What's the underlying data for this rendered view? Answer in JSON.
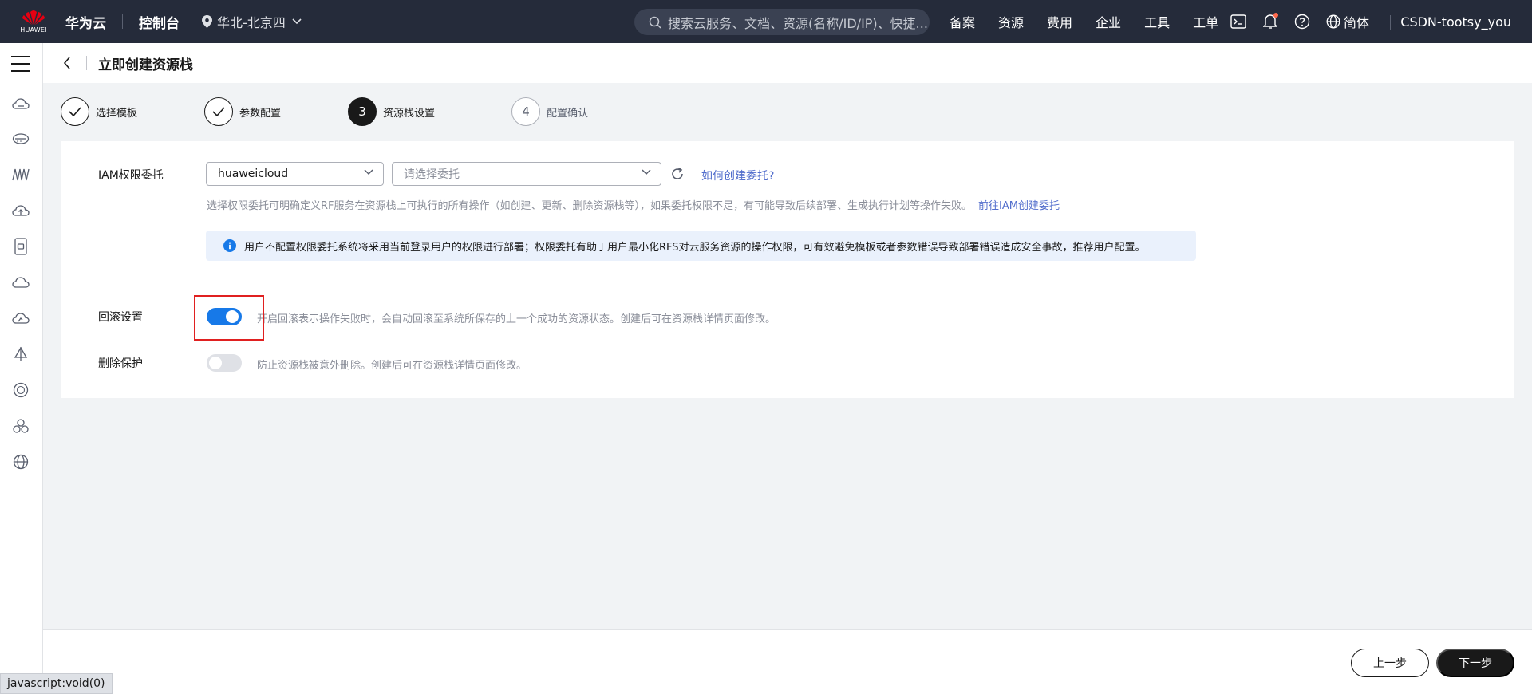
{
  "topbar": {
    "logo_text": "HUAWEI",
    "brand": "华为云",
    "console": "控制台",
    "region": "华北-北京四",
    "search_placeholder": "搜索云服务、文档、资源(名称/ID/IP)、快捷...",
    "nav": [
      "备案",
      "资源",
      "费用",
      "企业",
      "工具",
      "工单"
    ],
    "lang": "简体",
    "user": "CSDN-tootsy_you"
  },
  "header": {
    "title": "立即创建资源栈"
  },
  "steps": [
    {
      "num": "1",
      "label": "选择模板",
      "state": "done"
    },
    {
      "num": "2",
      "label": "参数配置",
      "state": "done"
    },
    {
      "num": "3",
      "label": "资源栈设置",
      "state": "active"
    },
    {
      "num": "4",
      "label": "配置确认",
      "state": "todo"
    }
  ],
  "iam": {
    "label": "IAM权限委托",
    "provider_value": "huaweicloud",
    "agency_placeholder": "请选择委托",
    "howto_link": "如何创建委托?",
    "help": "选择权限委托可明确定义RF服务在资源栈上可执行的所有操作（如创建、更新、删除资源栈等），如果委托权限不足，有可能导致后续部署、生成执行计划等操作失败。",
    "help_link": "前往IAM创建委托",
    "info": "用户不配置权限委托系统将采用当前登录用户的权限进行部署；权限委托有助于用户最小化RFS对云服务资源的操作权限，可有效避免模板或者参数错误导致部署错误造成安全事故，推荐用户配置。"
  },
  "rollback": {
    "label": "回滚设置",
    "enabled": true,
    "help": "开启回滚表示操作失败时，会自动回滚至系统所保存的上一个成功的资源状态。创建后可在资源栈详情页面修改。"
  },
  "delete_protect": {
    "label": "删除保护",
    "enabled": false,
    "help": "防止资源栈被意外删除。创建后可在资源栈详情页面修改。"
  },
  "footer": {
    "prev": "上一步",
    "next": "下一步"
  },
  "statusbar": "javascript:void(0)",
  "colors": {
    "topbar": "#252b3a",
    "accent": "#1779e8",
    "link": "#526ecc",
    "highlight": "#e02020"
  }
}
